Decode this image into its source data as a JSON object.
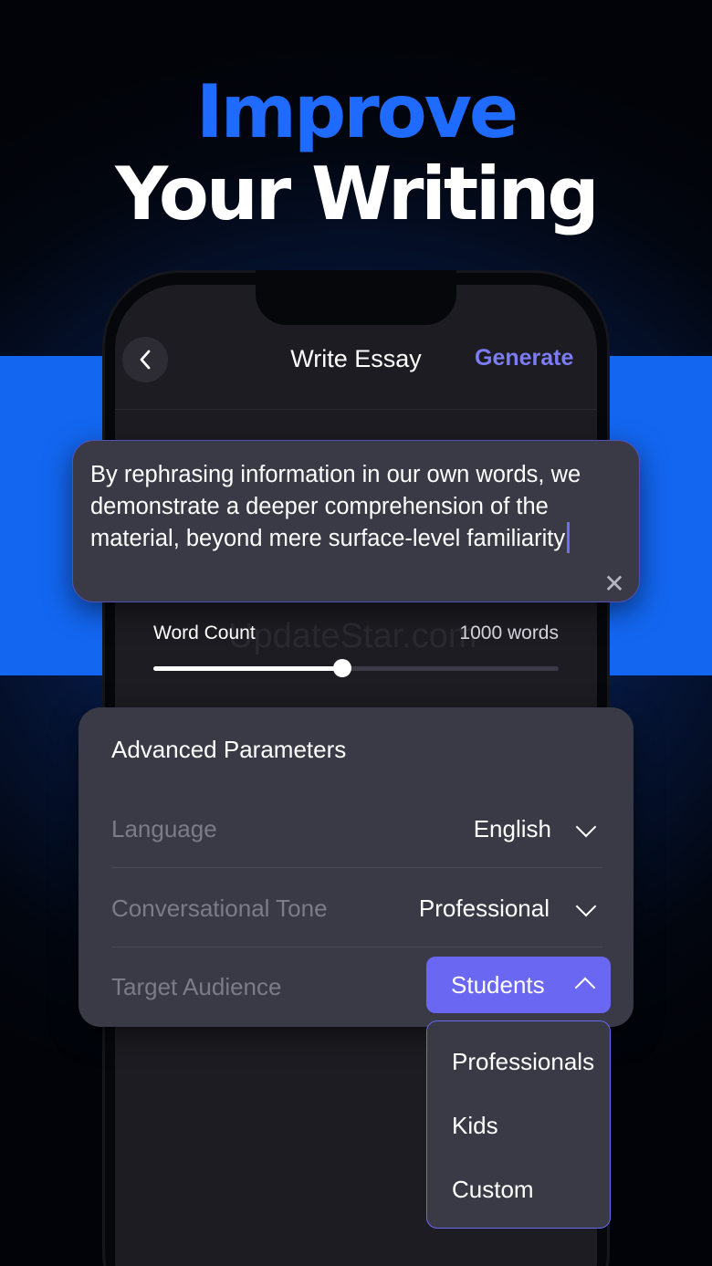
{
  "headline": {
    "line1": "Improve",
    "line2": "Your Writing"
  },
  "nav": {
    "title": "Write Essay",
    "generate_label": "Generate"
  },
  "essay": {
    "text": "By rephrasing information in our own words, we demonstrate a deeper comprehension of the material, beyond mere surface-level familiarity"
  },
  "word_count": {
    "label": "Word Count",
    "value_text": "1000 words",
    "slider_fraction": 0.466
  },
  "watermark": "UpdateStar.com",
  "advanced": {
    "title": "Advanced Parameters",
    "language": {
      "label": "Language",
      "value": "English"
    },
    "tone": {
      "label": "Conversational Tone",
      "value": "Professional"
    },
    "audience": {
      "label": "Target Audience",
      "value": "Students",
      "options": [
        "Professionals",
        "Kids",
        "Custom"
      ]
    }
  },
  "colors": {
    "accent": "#6a67f2",
    "brand_blue": "#1f6bff",
    "card": "#3a3946",
    "screen": "#1d1c22"
  }
}
